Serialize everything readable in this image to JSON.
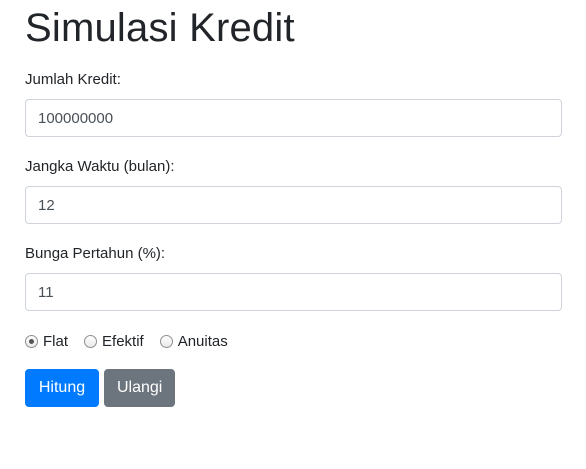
{
  "page": {
    "title": "Simulasi Kredit"
  },
  "form": {
    "jumlah": {
      "label": "Jumlah Kredit:",
      "value": "100000000"
    },
    "jangka": {
      "label": "Jangka Waktu (bulan):",
      "value": "12"
    },
    "bunga": {
      "label": "Bunga Pertahun (%):",
      "value": "11"
    },
    "methods": [
      {
        "label": "Flat",
        "checked": true
      },
      {
        "label": "Efektif",
        "checked": false
      },
      {
        "label": "Anuitas",
        "checked": false
      }
    ],
    "buttons": {
      "submit": "Hitung",
      "reset": "Ulangi"
    }
  },
  "colors": {
    "primary": "#007bff",
    "secondary": "#6c757d",
    "input_border": "#ced4da",
    "text": "#212529"
  }
}
